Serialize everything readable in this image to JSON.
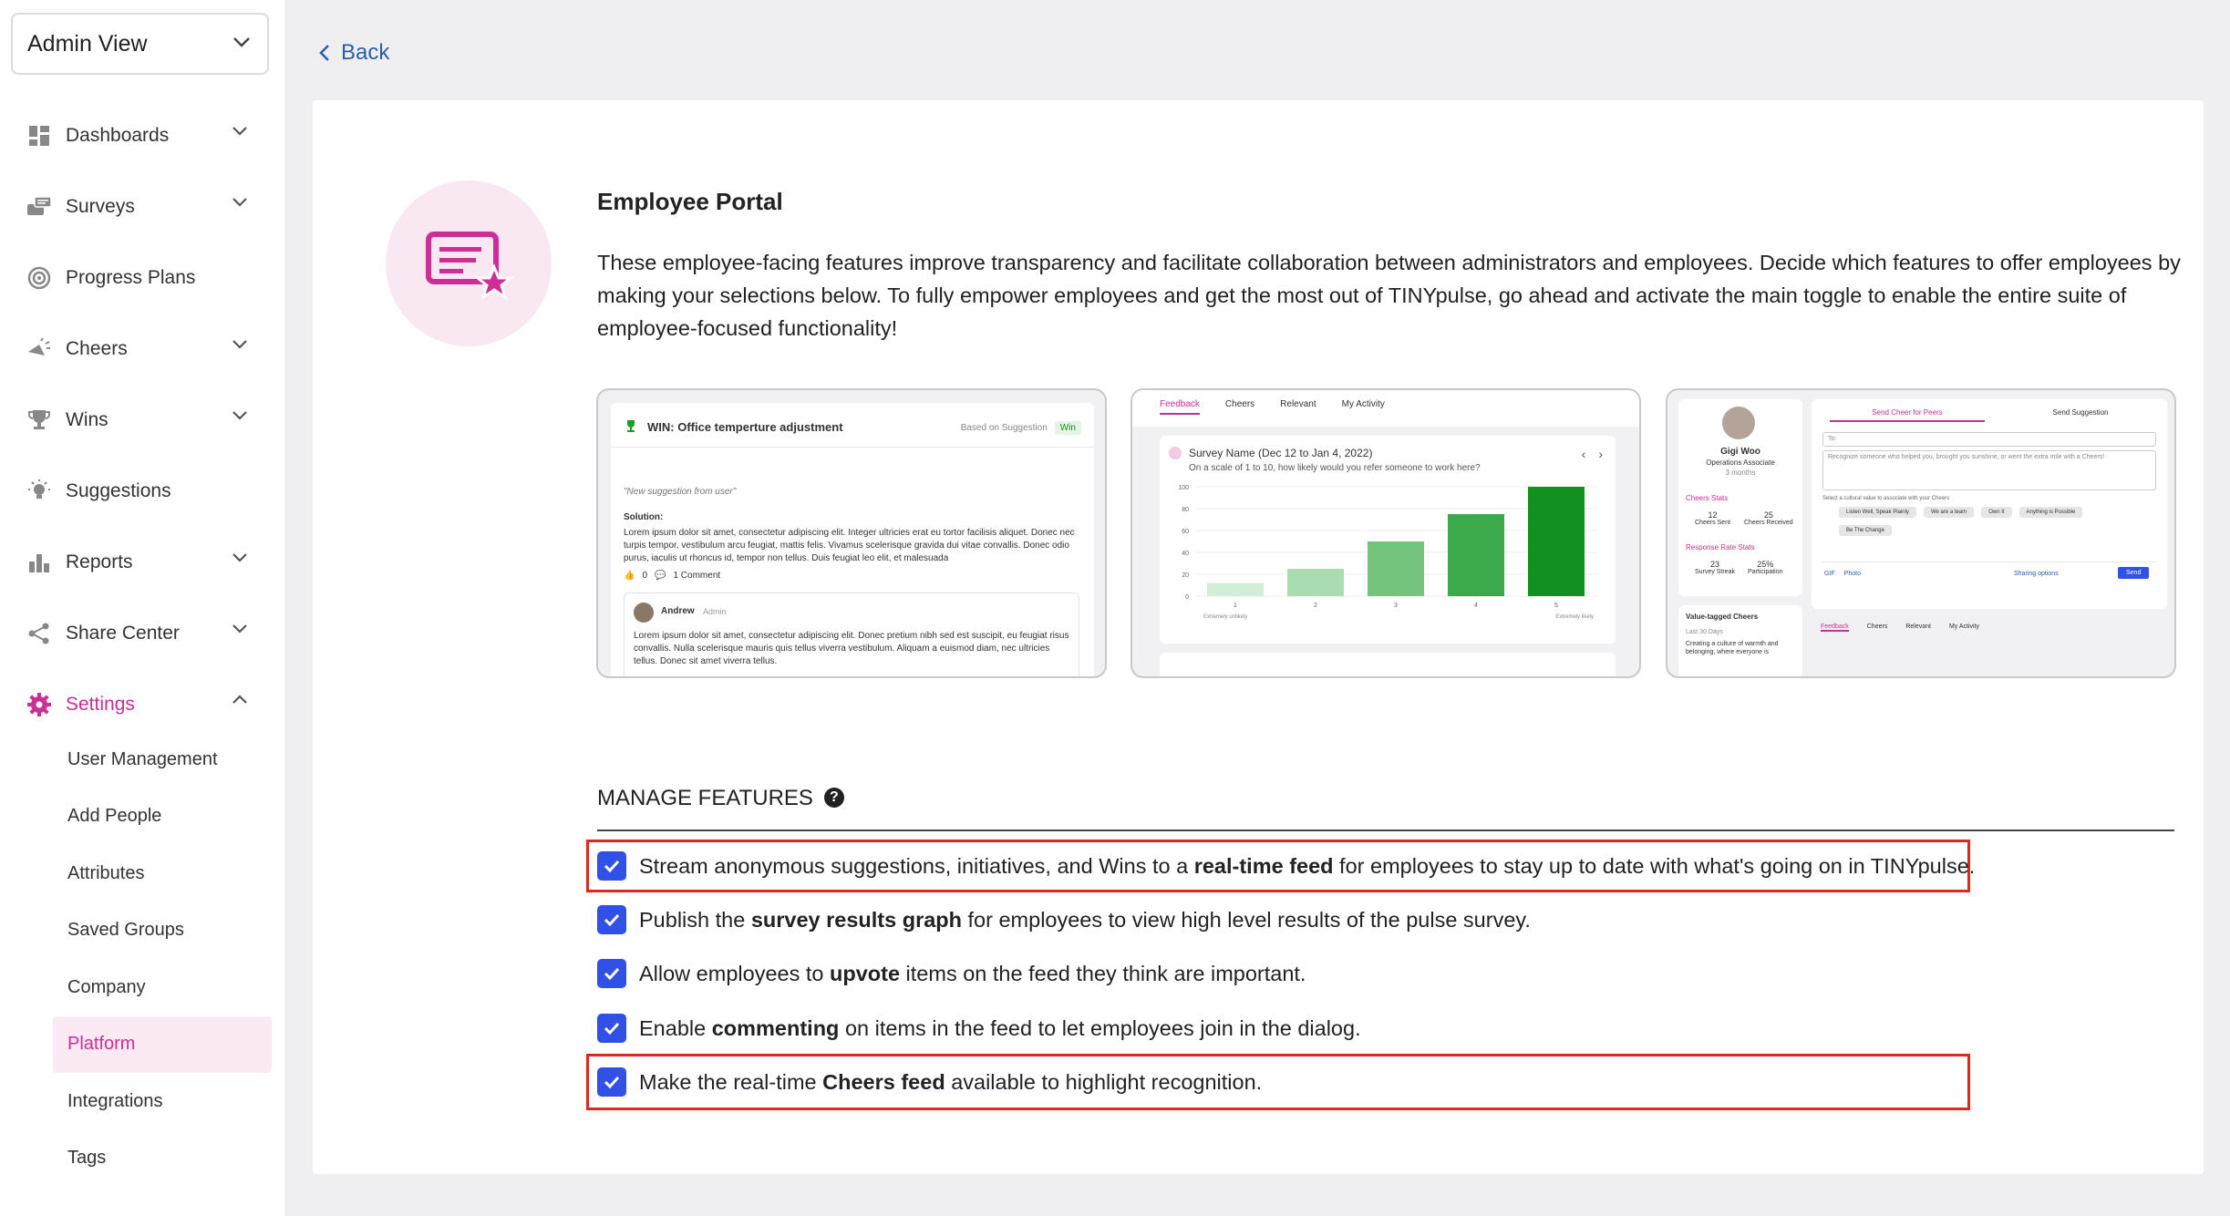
{
  "sidebar": {
    "view_select": "Admin View",
    "items": [
      {
        "label": "Dashboards",
        "icon": "dashboard-icon",
        "expandable": true
      },
      {
        "label": "Surveys",
        "icon": "surveys-icon",
        "expandable": true
      },
      {
        "label": "Progress Plans",
        "icon": "progress-plans-icon",
        "expandable": false
      },
      {
        "label": "Cheers",
        "icon": "cheers-megaphone-icon",
        "expandable": true
      },
      {
        "label": "Wins",
        "icon": "trophy-icon",
        "expandable": true
      },
      {
        "label": "Suggestions",
        "icon": "lightbulb-icon",
        "expandable": false
      },
      {
        "label": "Reports",
        "icon": "bar-chart-icon",
        "expandable": true
      },
      {
        "label": "Share Center",
        "icon": "share-icon",
        "expandable": true
      },
      {
        "label": "Settings",
        "icon": "gear-icon",
        "expandable": true,
        "active": true
      }
    ],
    "settings_sub": [
      "User Management",
      "Add People",
      "Attributes",
      "Saved Groups",
      "Company",
      "Platform",
      "Integrations",
      "Tags"
    ],
    "active_sub": "Platform",
    "accent_color": "#cc2e96"
  },
  "back": "Back",
  "portal": {
    "title": "Employee Portal",
    "description": "These employee-facing features improve transparency and facilitate collaboration between administrators and employees. Decide which features to offer employees by making your selections below. To fully empower employees and get the most out of TINYpulse, go ahead and activate the main toggle to enable the entire suite of employee-focused functionality!"
  },
  "previews": {
    "win": {
      "title": "WIN: Office temperture adjustment",
      "tag_based": "Based on Suggestion",
      "tag_win": "Win",
      "quote": "\"New suggestion from user\"",
      "solution_label": "Solution:",
      "body": "Lorem ipsum dolor sit amet, consectetur adipiscing elit. Integer ultricies erat eu tortor facilisis aliquet. Donec nec turpis tempor, vestibulum arcu feugiat, mattis felis. Vivamus scelerisque gravida dui vitae convallis. Donec odio purus, iaculis ut rhoncus id, tempor non tellus. Duis feugiat leo elit, et malesuada",
      "upvotes": "0",
      "comments": "1 Comment",
      "commenter": "Andrew",
      "commenter_role": "Admin",
      "comment": "Lorem ipsum dolor sit amet, consectetur adipiscing elit. Donec pretium nibh sed est suscipit, eu feugiat risus convallis. Nulla scelerisque mauris quis tellus viverra vestibulum. Aliquam a euismod diam, nec ultricies tellus. Donec sit amet viverra tellus."
    },
    "survey": {
      "tabs": [
        "Feedback",
        "Cheers",
        "Relevant",
        "My Activity"
      ],
      "survey_name": "Survey Name (Dec 12 to Jan 4, 2022)",
      "question": "On a scale of 1 to 10, how likely would you refer someone to work here?",
      "yticks": [
        "100",
        "80",
        "60",
        "40",
        "20",
        "0"
      ],
      "xticks": [
        "1",
        "2",
        "3",
        "4",
        "5"
      ],
      "x_left": "Extremely unlikely",
      "x_right": "Extremely likely",
      "values": [
        12,
        25,
        50,
        75,
        100
      ],
      "colors": [
        "#d3eed6",
        "#a9dcae",
        "#74c47d",
        "#3ca94a",
        "#13901f"
      ]
    },
    "cheers": {
      "name": "Gigi Woo",
      "role": "Operations Associate",
      "tenure": "3 months",
      "cheers_stats": "Cheers Stats",
      "sent": "12",
      "sent_label": "Cheers Sent",
      "received": "25",
      "received_label": "Cheers Received",
      "response_stats": "Response Rate Stats",
      "streak": "23",
      "streak_label": "Survey Streak",
      "participation": "25%",
      "participation_label": "Participation",
      "tab_send": "Send Cheer for Peers",
      "tab_suggest": "Send Suggestion",
      "to": "To:",
      "message_placeholder": "Recognize someone who helped you, brought you sunshine, or went the extra mile with a Cheers!",
      "value_hint": "Select a cultural value to associate with your Cheers",
      "chips": [
        "Listen Well, Speak Plainly",
        "We are a team",
        "Own It",
        "Anything is Possible",
        "Be The Change"
      ],
      "gif": "GIF",
      "photo": "Photo",
      "sharing": "Sharing options",
      "send": "Send",
      "value_tagged": "Value-tagged Cheers",
      "last30": "Last 30 Days",
      "culture": "Creating a culture of warmth and belonging, where everyone is",
      "feed_tabs": [
        "Feedback",
        "Cheers",
        "Relevant",
        "My Activity"
      ]
    }
  },
  "manage": {
    "header": "MANAGE FEATURES",
    "features": [
      {
        "pre": "Stream anonymous suggestions, initiatives, and Wins to a ",
        "bold": "real-time feed",
        "post": " for employees to stay up to date with what's going on in TINYpulse.",
        "checked": true,
        "highlighted": true
      },
      {
        "pre": "Publish the ",
        "bold": "survey results graph",
        "post": " for employees to view high level results of the pulse survey.",
        "checked": true,
        "highlighted": false
      },
      {
        "pre": "Allow employees to ",
        "bold": "upvote",
        "post": " items on the feed they think are important.",
        "checked": true,
        "highlighted": false
      },
      {
        "pre": "Enable ",
        "bold": "commenting",
        "post": " on items in the feed to let employees join in the dialog.",
        "checked": true,
        "highlighted": false
      },
      {
        "pre": "Make the real-time ",
        "bold": "Cheers feed",
        "post": " available to highlight recognition.",
        "checked": true,
        "highlighted": true
      }
    ],
    "checkbox_color": "#3150e6",
    "highlight_color": "#e1271b"
  }
}
